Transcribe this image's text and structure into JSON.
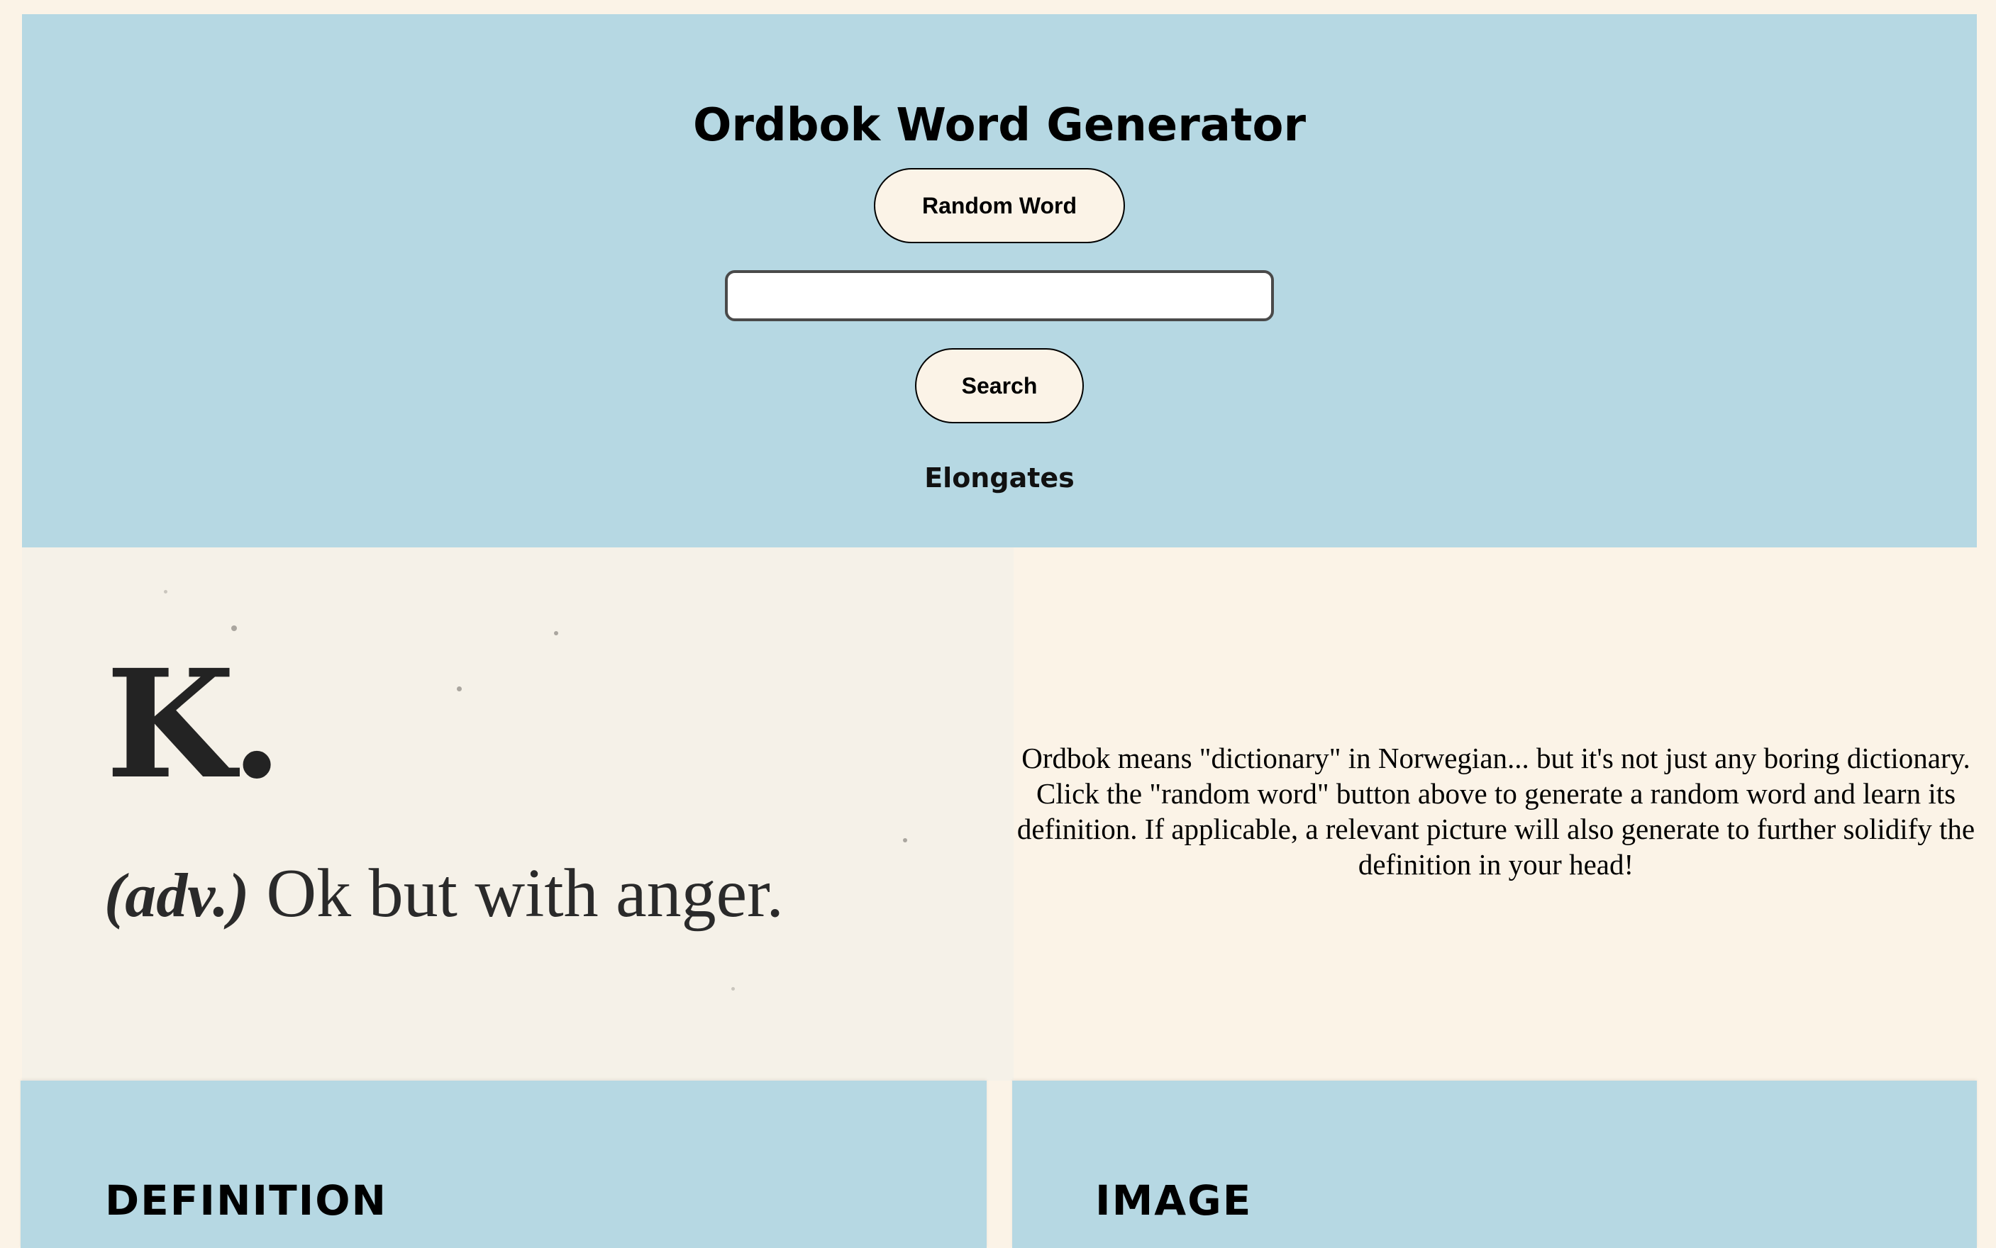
{
  "header": {
    "title": "Ordbok Word Generator",
    "random_button": "Random Word",
    "search_value": "",
    "search_placeholder": "",
    "search_button": "Search",
    "current_word": "Elongates"
  },
  "hero": {
    "letter": "K.",
    "part_of_speech": "(adv.)",
    "definition": "Ok but with anger."
  },
  "about": {
    "text": "Ordbok means \"dictionary\" in Norwegian... but it's not just any boring dictionary. Click the \"random word\" button above to generate a random word and learn its definition. If applicable, a relevant picture will also generate to further solidify the definition in your head!"
  },
  "panels": {
    "definition_title": "DEFINITION",
    "image_title": "IMAGE"
  },
  "colors": {
    "background": "#fbf3e7",
    "accent_blue": "#b6d8e3",
    "button_fill": "#fbf3e7"
  }
}
